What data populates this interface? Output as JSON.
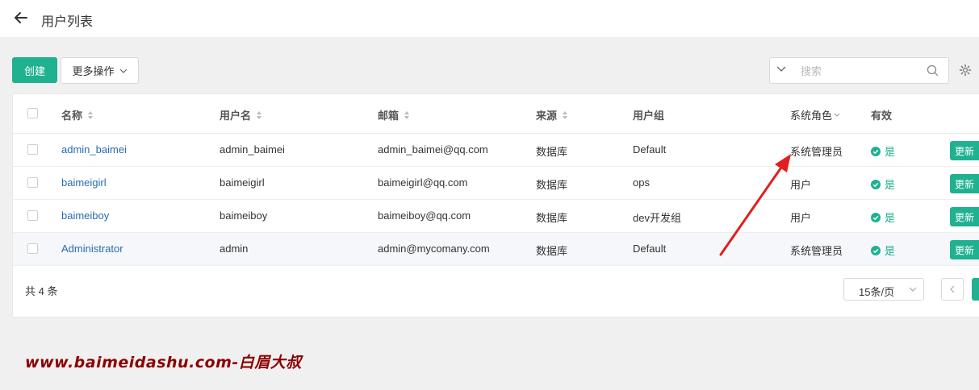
{
  "header": {
    "title": "用户列表",
    "back_icon": "arrow-left-icon"
  },
  "toolbar": {
    "create_label": "创建",
    "more_label": "更多操作",
    "search_placeholder": "搜索"
  },
  "table": {
    "columns": [
      "名称",
      "用户名",
      "邮箱",
      "来源",
      "用户组",
      "系统角色",
      "有效"
    ],
    "rows": [
      {
        "name": "admin_baimei",
        "username": "admin_baimei",
        "email": "admin_baimei@qq.com",
        "source": "数据库",
        "group": "Default",
        "role": "系统管理员",
        "valid": "是",
        "action": "更新"
      },
      {
        "name": "baimeigirl",
        "username": "baimeigirl",
        "email": "baimeigirl@qq.com",
        "source": "数据库",
        "group": "ops",
        "role": "用户",
        "valid": "是",
        "action": "更新"
      },
      {
        "name": "baimeiboy",
        "username": "baimeiboy",
        "email": "baimeiboy@qq.com",
        "source": "数据库",
        "group": "dev开发组",
        "role": "用户",
        "valid": "是",
        "action": "更新"
      },
      {
        "name": "Administrator",
        "username": "admin",
        "email": "admin@mycomany.com",
        "source": "数据库",
        "group": "Default",
        "role": "系统管理员",
        "valid": "是",
        "action": "更新"
      }
    ]
  },
  "footer": {
    "total": "共 4 条",
    "page_size": "15条/页"
  },
  "watermark": "www.baimeidashu.com-白眉大叔",
  "colors": {
    "accent": "#1fb190",
    "link": "#2a6bb0",
    "annotation_arrow": "#e02020",
    "watermark": "#8b0000"
  }
}
